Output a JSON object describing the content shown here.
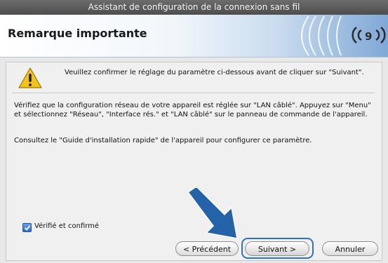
{
  "window": {
    "title": "Assistant de configuration de la connexion sans fil"
  },
  "header": {
    "title": "Remarque importante",
    "logo_icon": "wireless-signal-icon"
  },
  "notice": {
    "icon": "warning-icon",
    "text": "Veuillez confirmer le réglage du paramètre ci-dessous avant de cliquer sur \"Suivant\"."
  },
  "body": {
    "paragraph1": "Vérifiez que la configuration réseau de votre appareil est réglée sur \"LAN câblé\". Appuyez sur \"Menu\" et sélectionnez \"Réseau\", \"Interface rés.\" et \"LAN câblé\" sur le panneau de commande de l'appareil.",
    "paragraph2": "Consultez le \"Guide d'installation rapide\" de l'appareil pour configurer ce paramètre."
  },
  "confirm": {
    "label": "Vérifié et confirmé",
    "checked": true
  },
  "buttons": {
    "prev": "< Précédent",
    "next": "Suivant >",
    "cancel": "Annuler"
  },
  "colors": {
    "accent": "#2d73c4",
    "arrow": "#2563a8"
  }
}
